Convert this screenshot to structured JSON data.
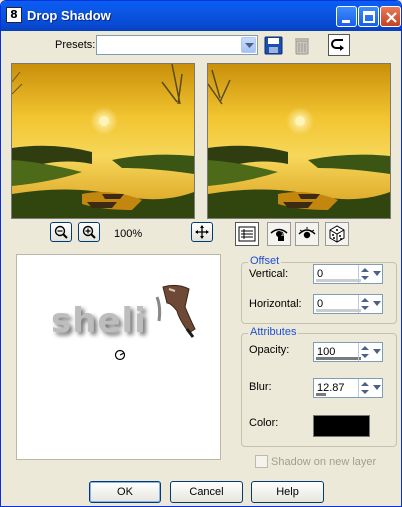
{
  "window": {
    "title": "Drop Shadow",
    "app_icon_text": "8"
  },
  "presets": {
    "label": "Presets:",
    "value": ""
  },
  "zoom": {
    "level": "100%"
  },
  "canvas": {
    "logo_text": "sheli"
  },
  "offset": {
    "title": "Offset",
    "vertical_label": "Vertical:",
    "vertical_value": "0",
    "horizontal_label": "Horizontal:",
    "horizontal_value": "0"
  },
  "attributes": {
    "title": "Attributes",
    "opacity_label": "Opacity:",
    "opacity_value": "100",
    "blur_label": "Blur:",
    "blur_value": "12.87",
    "color_label": "Color:",
    "color_value": "#000000"
  },
  "shadow_on_new_layer": {
    "label": "Shadow on new layer",
    "checked": false
  },
  "buttons": {
    "ok": "OK",
    "cancel": "Cancel",
    "help": "Help"
  }
}
